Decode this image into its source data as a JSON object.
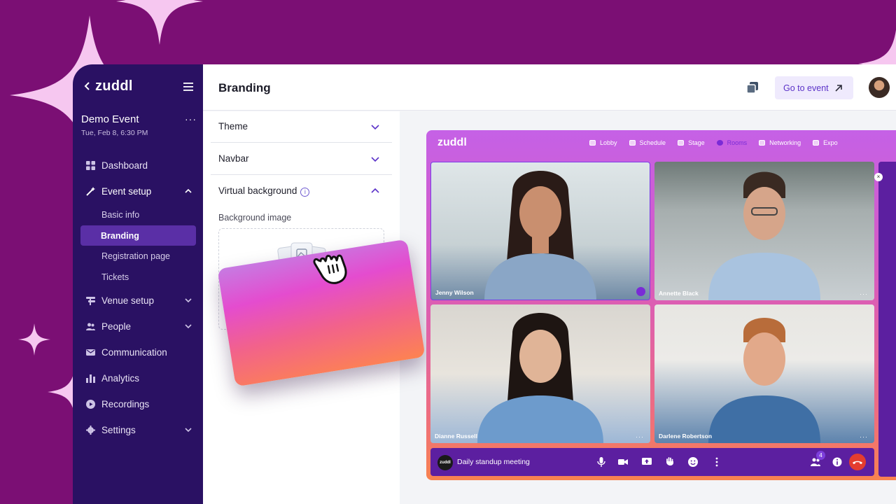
{
  "sidebar": {
    "logo": "zuddl",
    "event_name": "Demo Event",
    "event_date": "Tue, Feb 8, 6:30 PM",
    "event_more": "···",
    "nav": [
      {
        "label": "Dashboard",
        "icon": "dashboard-icon"
      },
      {
        "label": "Event setup",
        "icon": "magic-wand-icon"
      },
      {
        "label": "Venue setup",
        "icon": "venue-icon"
      },
      {
        "label": "People",
        "icon": "people-icon"
      },
      {
        "label": "Communication",
        "icon": "mail-icon"
      },
      {
        "label": "Analytics",
        "icon": "bar-chart-icon"
      },
      {
        "label": "Recordings",
        "icon": "play-icon"
      },
      {
        "label": "Settings",
        "icon": "gear-icon"
      }
    ],
    "sub_items": [
      "Basic info",
      "Branding",
      "Registration page",
      "Tickets"
    ],
    "active_sub": "Branding"
  },
  "header": {
    "title": "Branding",
    "goto_label": "Go to event"
  },
  "settings": {
    "sections": [
      "Theme",
      "Navbar",
      "Virtual background"
    ],
    "info_glyph": "i",
    "bg_image_label": "Background image"
  },
  "preview": {
    "logo": "zuddl",
    "nav": [
      "Lobby",
      "Schedule",
      "Stage",
      "Rooms",
      "Networking",
      "Expo"
    ],
    "active_nav": "Rooms",
    "participants": [
      "Jenny Wilson",
      "Annette Black",
      "Dianne Russell",
      "Darlene Robertson"
    ],
    "tile_more": "···",
    "meeting_logo": "zuddl",
    "meeting_title": "Daily standup meeting",
    "people_count": "4",
    "close_glyph": "×"
  },
  "colors": {
    "background": "#7b0f74",
    "sidebar": "#2a1163",
    "accent": "#5b32c8",
    "sparkle": "#f6c7f0"
  }
}
